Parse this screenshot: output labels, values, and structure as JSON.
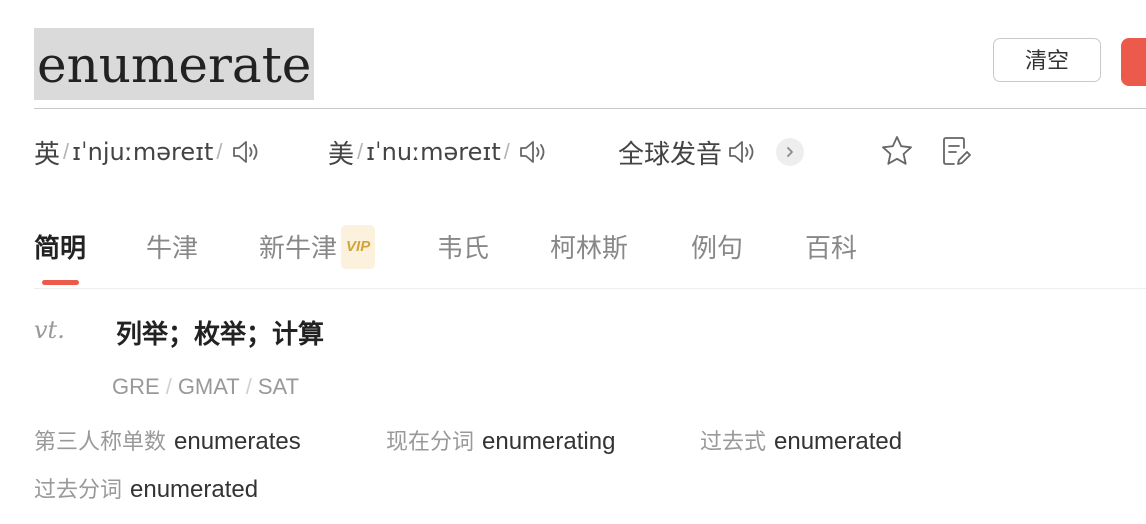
{
  "search": {
    "word": "enumerate",
    "clear_label": "清空"
  },
  "pronunciation": {
    "uk": {
      "label": "英",
      "ipa": "ɪˈnjuːməreɪt"
    },
    "us": {
      "label": "美",
      "ipa": "ɪˈnuːməreɪt"
    },
    "global": {
      "label": "全球发音"
    }
  },
  "tabs": [
    {
      "label": "简明",
      "active": true
    },
    {
      "label": "牛津"
    },
    {
      "label": "新牛津",
      "badge": "VIP"
    },
    {
      "label": "韦氏"
    },
    {
      "label": "柯林斯"
    },
    {
      "label": "例句"
    },
    {
      "label": "百科"
    }
  ],
  "definition": {
    "pos": "vt.",
    "meaning": "列举；枚举；计算"
  },
  "exams": [
    "GRE",
    "GMAT",
    "SAT"
  ],
  "forms": [
    {
      "label": "第三人称单数",
      "value": "enumerates"
    },
    {
      "label": "现在分词",
      "value": "enumerating"
    },
    {
      "label": "过去式",
      "value": "enumerated"
    },
    {
      "label": "过去分词",
      "value": "enumerated"
    }
  ],
  "colors": {
    "accent": "#ec5a4b",
    "vip": "#d4a43a",
    "muted": "#999999"
  },
  "icons": [
    "speaker-icon",
    "chevron-right-icon",
    "star-icon",
    "note-edit-icon"
  ]
}
